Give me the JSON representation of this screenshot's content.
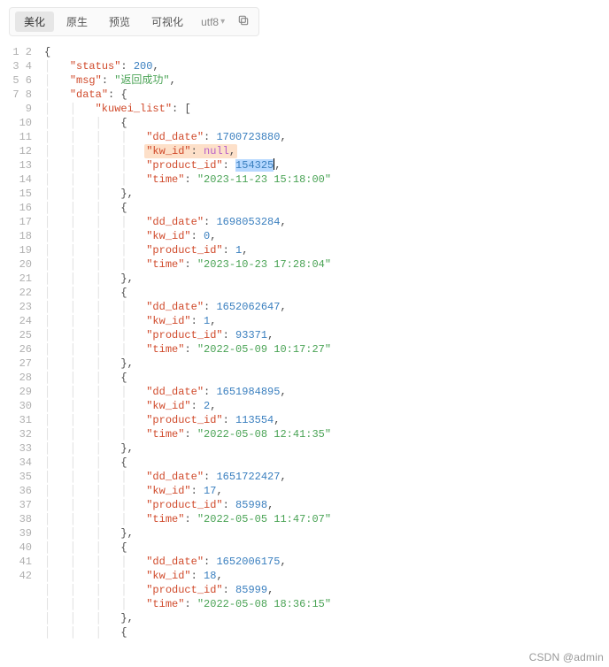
{
  "tabs": {
    "beautify": "美化",
    "raw": "原生",
    "preview": "预览",
    "visual": "可视化",
    "encoding": "utf8",
    "copy_title": "copy"
  },
  "json": {
    "status": 200,
    "msg": "返回成功",
    "data_key": "data",
    "list_key": "kuwei_list",
    "items": [
      {
        "dd_date": 1700723880,
        "kw_id": null,
        "product_id": 154325,
        "time": "2023-11-23 15:18:00"
      },
      {
        "dd_date": 1698053284,
        "kw_id": 0,
        "product_id": 1,
        "time": "2023-10-23 17:28:04"
      },
      {
        "dd_date": 1652062647,
        "kw_id": 1,
        "product_id": 93371,
        "time": "2022-05-09 10:17:27"
      },
      {
        "dd_date": 1651984895,
        "kw_id": 2,
        "product_id": 113554,
        "time": "2022-05-08 12:41:35"
      },
      {
        "dd_date": 1651722427,
        "kw_id": 17,
        "product_id": 85998,
        "time": "2022-05-05 11:47:07"
      },
      {
        "dd_date": 1652006175,
        "kw_id": 18,
        "product_id": 85999,
        "time": "2022-05-08 18:36:15"
      }
    ]
  },
  "highlight_item_index": 0,
  "selected_value_path": "json.items.0.product_id",
  "field_labels": {
    "dd_date": "dd_date",
    "kw_id": "kw_id",
    "product_id": "product_id",
    "time": "time"
  },
  "watermark": "CSDN @admin"
}
